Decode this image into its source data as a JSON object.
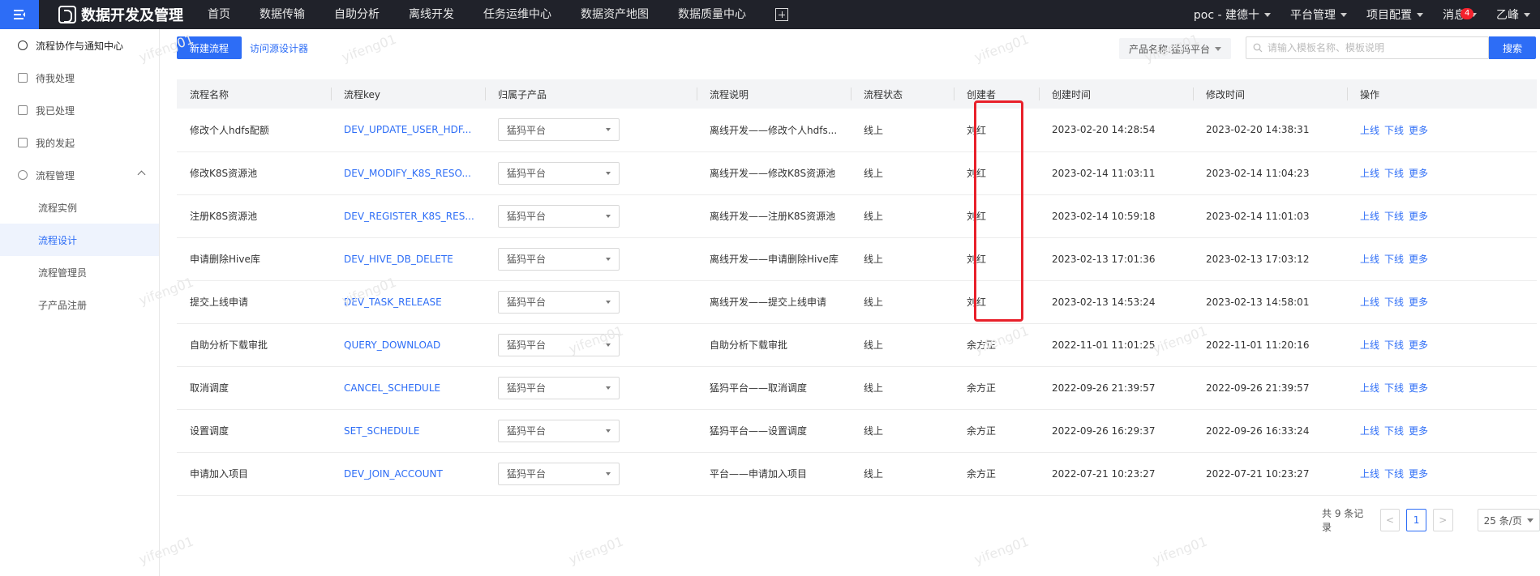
{
  "topbar": {
    "brand_title": "数据开发及管理",
    "nav": [
      "首页",
      "数据传输",
      "自助分析",
      "离线开发",
      "任务运维中心",
      "数据资产地图",
      "数据质量中心"
    ],
    "project": "poc - 建德十",
    "platform": "平台管理",
    "project_config": "项目配置",
    "messages": "消息",
    "message_count": "4",
    "user": "乙峰"
  },
  "sidebar": {
    "header": "流程协作与通知中心",
    "items": [
      "待我处理",
      "我已处理",
      "我的发起",
      "流程管理"
    ],
    "sub_items": [
      "流程实例",
      "流程设计",
      "流程管理员",
      "子产品注册"
    ]
  },
  "toolbar": {
    "new_flow": "新建流程",
    "visit_designer": "访问源设计器",
    "product_filter": "产品名称:猛犸平台",
    "search_placeholder": "请输入模板名称、模板说明",
    "search_button": "搜索"
  },
  "table": {
    "headers": [
      "流程名称",
      "流程key",
      "归属子产品",
      "流程说明",
      "流程状态",
      "创建者",
      "创建时间",
      "修改时间",
      "操作"
    ],
    "rows": [
      {
        "name": "修改个人hdfs配额",
        "key": "DEV_UPDATE_USER_HDF...",
        "product": "猛犸平台",
        "desc": "离线开发——修改个人hdfs...",
        "status": "线上",
        "creator": "刘红",
        "created": "2023-02-20 14:28:54",
        "modified": "2023-02-20 14:38:31"
      },
      {
        "name": "修改K8S资源池",
        "key": "DEV_MODIFY_K8S_RESO...",
        "product": "猛犸平台",
        "desc": "离线开发——修改K8S资源池",
        "status": "线上",
        "creator": "刘红",
        "created": "2023-02-14 11:03:11",
        "modified": "2023-02-14 11:04:23"
      },
      {
        "name": "注册K8S资源池",
        "key": "DEV_REGISTER_K8S_RES...",
        "product": "猛犸平台",
        "desc": "离线开发——注册K8S资源池",
        "status": "线上",
        "creator": "刘红",
        "created": "2023-02-14 10:59:18",
        "modified": "2023-02-14 11:01:03"
      },
      {
        "name": "申请删除Hive库",
        "key": "DEV_HIVE_DB_DELETE",
        "product": "猛犸平台",
        "desc": "离线开发——申请删除Hive库",
        "status": "线上",
        "creator": "刘红",
        "created": "2023-02-13 17:01:36",
        "modified": "2023-02-13 17:03:12"
      },
      {
        "name": "提交上线申请",
        "key": "DEV_TASK_RELEASE",
        "product": "猛犸平台",
        "desc": "离线开发——提交上线申请",
        "status": "线上",
        "creator": "刘红",
        "created": "2023-02-13 14:53:24",
        "modified": "2023-02-13 14:58:01"
      },
      {
        "name": "自助分析下载审批",
        "key": "QUERY_DOWNLOAD",
        "product": "猛犸平台",
        "desc": "自助分析下载审批",
        "status": "线上",
        "creator": "余方正",
        "created": "2022-11-01 11:01:25",
        "modified": "2022-11-01 11:20:16"
      },
      {
        "name": "取消调度",
        "key": "CANCEL_SCHEDULE",
        "product": "猛犸平台",
        "desc": "猛犸平台——取消调度",
        "status": "线上",
        "creator": "余方正",
        "created": "2022-09-26 21:39:57",
        "modified": "2022-09-26 21:39:57"
      },
      {
        "name": "设置调度",
        "key": "SET_SCHEDULE",
        "product": "猛犸平台",
        "desc": "猛犸平台——设置调度",
        "status": "线上",
        "creator": "余方正",
        "created": "2022-09-26 16:29:37",
        "modified": "2022-09-26 16:33:24"
      },
      {
        "name": "申请加入项目",
        "key": "DEV_JOIN_ACCOUNT",
        "product": "猛犸平台",
        "desc": "平台——申请加入项目",
        "status": "线上",
        "creator": "余方正",
        "created": "2022-07-21 10:23:27",
        "modified": "2022-07-21 10:23:27"
      }
    ],
    "ops": [
      "上线",
      "下线",
      "更多"
    ]
  },
  "pagination": {
    "total": "共 9 条记录",
    "current_page": "1",
    "page_size": "25 条/页"
  },
  "watermark": "yifeng01",
  "colors": {
    "accent": "#2d6df6",
    "topbar": "#20222a",
    "highlight": "#e8202a"
  }
}
